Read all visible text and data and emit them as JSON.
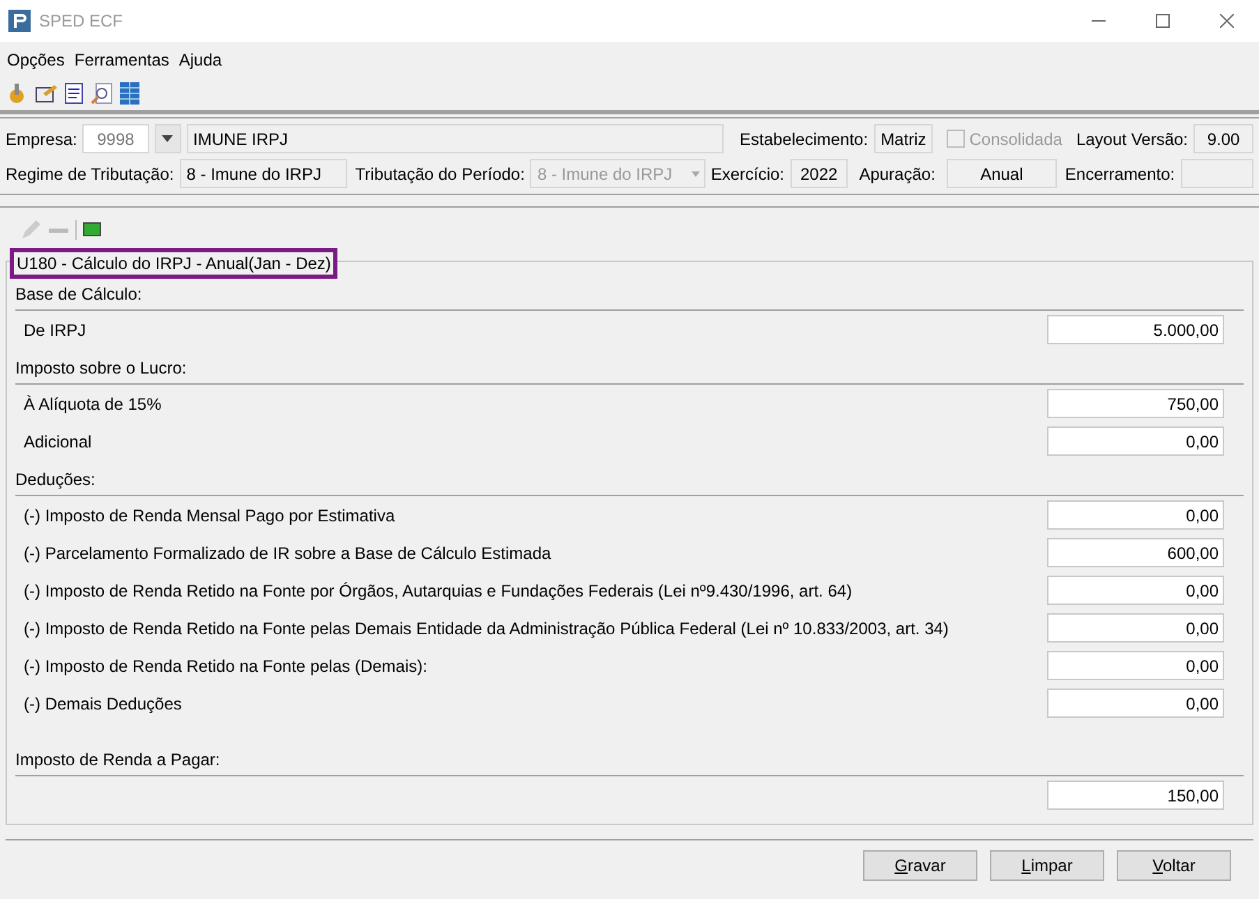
{
  "window": {
    "title": "SPED ECF"
  },
  "menu": [
    "Opções",
    "Ferramentas",
    "Ajuda"
  ],
  "header": {
    "empresa_label": "Empresa:",
    "empresa_code": "9998",
    "empresa_name": "IMUNE IRPJ",
    "estabelecimento_label": "Estabelecimento:",
    "estabelecimento": "Matriz",
    "consolidada": {
      "label": "Consolidada",
      "checked": false,
      "disabled": true
    },
    "layout_label": "Layout Versão:",
    "layout": "9.00",
    "regime_label": "Regime de Tributação:",
    "regime": "8 - Imune do IRPJ",
    "periodo_label": "Tributação do Período:",
    "periodo": "8 - Imune do IRPJ",
    "exercicio_label": "Exercício:",
    "exercicio": "2022",
    "apuracao_label": "Apuração:",
    "apuracao": "Anual",
    "encerramento_label": "Encerramento:"
  },
  "group": {
    "title": "U180 - Cálculo do IRPJ - Anual(Jan - Dez)",
    "sections": [
      {
        "title": "Base de Cálculo:",
        "rows": [
          {
            "label": "De IRPJ",
            "value": "5.000,00"
          }
        ]
      },
      {
        "title": "Imposto sobre o Lucro:",
        "rows": [
          {
            "label": "À Alíquota de 15%",
            "value": "750,00"
          },
          {
            "label": "Adicional",
            "value": "0,00"
          }
        ]
      },
      {
        "title": "Deduções:",
        "rows": [
          {
            "label": "(-) Imposto de Renda Mensal Pago por Estimativa",
            "value": "0,00"
          },
          {
            "label": "(-) Parcelamento Formalizado de IR sobre a Base de Cálculo Estimada",
            "value": "600,00"
          },
          {
            "label": "(-) Imposto de Renda Retido na Fonte por Órgãos, Autarquias e Fundações Federais (Lei nº9.430/1996, art. 64)",
            "value": "0,00"
          },
          {
            "label": "(-) Imposto de Renda Retido na Fonte pelas Demais Entidade da Administração Pública Federal (Lei nº 10.833/2003, art. 34)",
            "value": "0,00"
          },
          {
            "label": "(-) Imposto de Renda Retido na Fonte pelas (Demais):",
            "value": "0,00"
          },
          {
            "label": "(-) Demais Deduções",
            "value": "0,00"
          }
        ]
      },
      {
        "title": "Imposto de Renda a Pagar:",
        "rows": [
          {
            "value": "150,00"
          }
        ]
      }
    ]
  },
  "buttons": [
    "Gravar",
    "Limpar",
    "Voltar"
  ]
}
